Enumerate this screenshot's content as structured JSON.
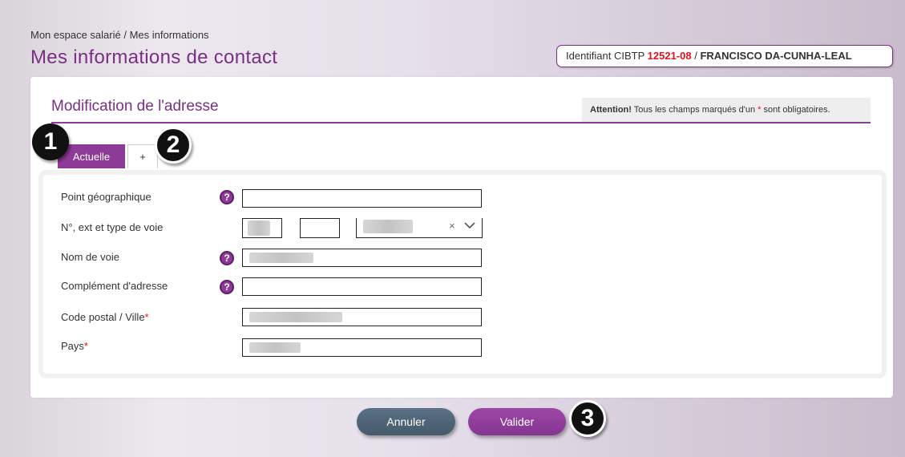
{
  "header": {
    "breadcrumb": "Mon espace salarié / Mes informations",
    "title": "Mes informations de contact",
    "id_label": "Identifiant CIBTP ",
    "id_number": "12521-08",
    "id_separator": " / ",
    "id_name": "FRANCISCO DA-CUNHA-LEAL"
  },
  "section": {
    "title": "Modification de l'adresse",
    "attention_bold": "Attention!",
    "attention_text_before": " Tous les champs marqués d'un ",
    "attention_star": "*",
    "attention_text_after": " sont obligatoires."
  },
  "tabs": [
    {
      "label": "Actuelle",
      "active": true
    },
    {
      "label": "+",
      "active": false
    }
  ],
  "form": {
    "point_geo_label": "Point géographique",
    "voie_label": "N°, ext et type de voie",
    "nom_voie_label": "Nom de voie",
    "complement_label": "Complément d'adresse",
    "code_postal_label": "Code postal / Ville",
    "pays_label": "Pays",
    "required_star": "*",
    "help_glyph": "?",
    "select_clear_glyph": "×"
  },
  "buttons": {
    "cancel": "Annuler",
    "submit": "Valider"
  },
  "markers": [
    "1",
    "2",
    "3"
  ],
  "colors": {
    "accent": "#8e3a97",
    "required": "#e0141e",
    "cancel_button": "#4f6577"
  }
}
